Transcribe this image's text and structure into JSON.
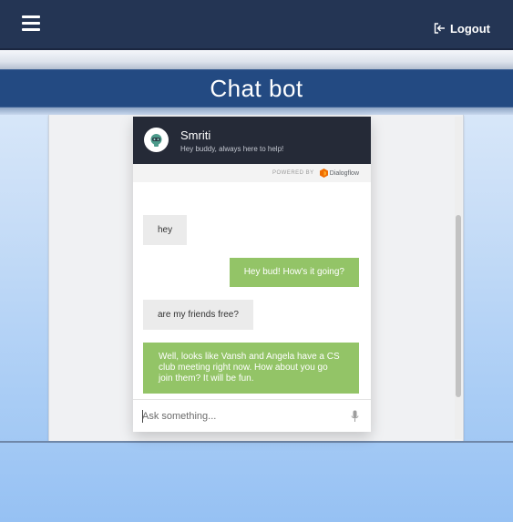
{
  "topbar": {
    "menu_icon": "hamburger-icon",
    "logout_icon": "logout-arrow-icon",
    "logout_label": "Logout"
  },
  "page": {
    "title": "Chat bot"
  },
  "chat": {
    "bot_name": "Smriti",
    "bot_tagline": "Hey buddy, always here to help!",
    "avatar_icon": "bot-avatar-icon",
    "powered_by_label": "POWERED BY",
    "powered_by_brand": "Dialogflow",
    "messages": [
      {
        "sender": "user",
        "text": "hey"
      },
      {
        "sender": "bot",
        "text": "Hey bud! How's it going?"
      },
      {
        "sender": "user",
        "text": "are my friends free?"
      },
      {
        "sender": "bot",
        "text": "Well, looks like Vansh and Angela have a CS club meeting right now. How about you go join them? It will be fun."
      }
    ],
    "input": {
      "placeholder": "Ask something...",
      "value": ""
    },
    "mic_icon": "microphone-icon"
  },
  "colors": {
    "topbar": "#243554",
    "title_bar": "#234a82",
    "chat_header": "#252a37",
    "bot_bubble": "#93c467",
    "user_bubble": "#ebebeb"
  }
}
